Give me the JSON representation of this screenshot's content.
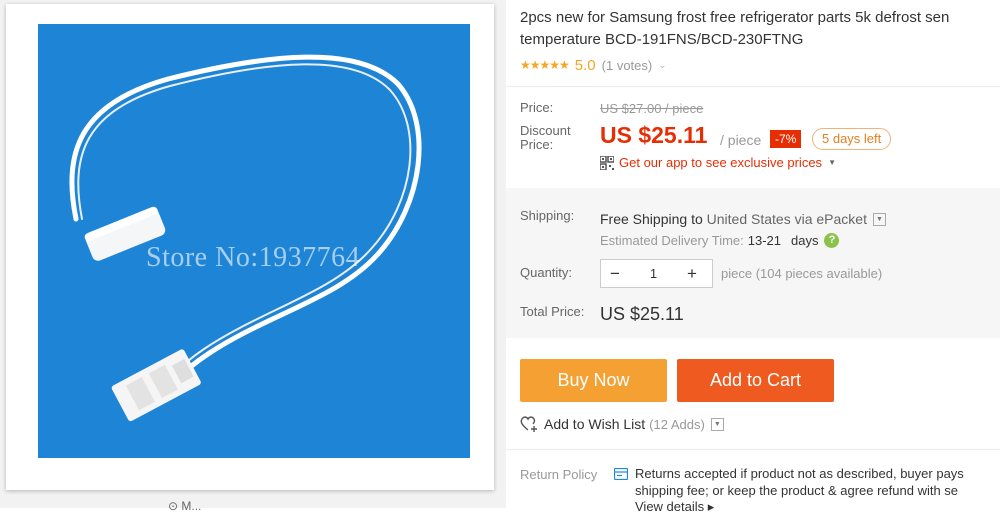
{
  "product": {
    "title_line1": "2pcs new for Samsung frost free refrigerator parts 5k defrost sen",
    "title_line2": "temperature BCD-191FNS/BCD-230FTNG",
    "stars": "★★★★★",
    "rating": "5.0",
    "votes": "(1 votes)",
    "watermark": "Store No:1937764",
    "more_peek": "⊙ M..."
  },
  "price": {
    "price_label": "Price:",
    "original": "US $27.00 / piece",
    "discount_label_line1": "Discount",
    "discount_label_line2": "Price:",
    "discount_value": "US $25.11",
    "per_piece": "/ piece",
    "percent_off": "-7%",
    "days_left": "5 days left",
    "app_promo": "Get our app to see exclusive prices"
  },
  "shipping": {
    "label": "Shipping:",
    "free": "Free Shipping",
    "to_text": "to",
    "country": "United States",
    "via_text": "via",
    "method": "ePacket",
    "est_label": "Estimated Delivery Time:",
    "est_value": "13-21",
    "days_label": "days"
  },
  "quantity": {
    "label": "Quantity:",
    "minus": "−",
    "value": "1",
    "plus": "+",
    "note": "piece (104 pieces available)"
  },
  "total": {
    "label": "Total Price:",
    "value": "US $25.11"
  },
  "actions": {
    "buy_now": "Buy Now",
    "add_to_cart": "Add to Cart",
    "wish_label": "Add to Wish List",
    "wish_count": "(12 Adds)"
  },
  "returns": {
    "label": "Return Policy",
    "line1": "Returns accepted if product not as described, buyer pays",
    "line2": "shipping fee; or keep the product & agree refund with se",
    "view_details": "View details ▸"
  },
  "colors": {
    "price_red": "#e62e04",
    "star_orange": "#f5a623",
    "buy_now_bg": "#f5a033",
    "cart_bg": "#ee5a1f",
    "photo_bg": "#1e84d6"
  }
}
